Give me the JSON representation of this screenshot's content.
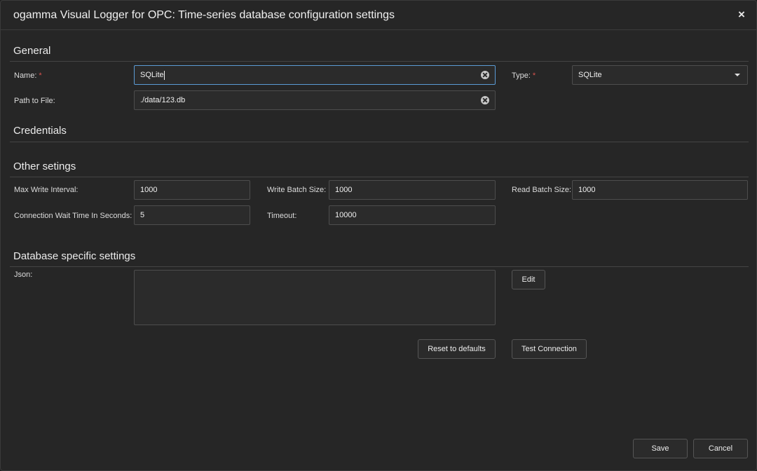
{
  "window": {
    "title": "ogamma Visual Logger for OPC: Time-series database configuration settings",
    "close_glyph": "×"
  },
  "sections": {
    "general": "General",
    "credentials": "Credentials",
    "other": "Other setings",
    "db_specific": "Database specific settings"
  },
  "general": {
    "name_label": "Name:",
    "name_required": "*",
    "name_value": "SQLite",
    "type_label": "Type:",
    "type_required": "*",
    "type_value": "SQLite",
    "path_label": "Path to File:",
    "path_value": "./data/123.db"
  },
  "other": {
    "max_write_interval_label": "Max Write Interval:",
    "max_write_interval_value": "1000",
    "write_batch_size_label": "Write Batch Size:",
    "write_batch_size_value": "1000",
    "read_batch_size_label": "Read Batch Size:",
    "read_batch_size_value": "1000",
    "conn_wait_label": "Connection Wait Time In Seconds:",
    "conn_wait_value": "5",
    "timeout_label": "Timeout:",
    "timeout_value": "10000"
  },
  "db_specific": {
    "json_label": "Json:",
    "json_value": "",
    "edit_button": "Edit",
    "reset_button": "Reset to defaults",
    "test_button": "Test Connection"
  },
  "footer": {
    "save_button": "Save",
    "cancel_button": "Cancel"
  },
  "icons": {
    "clear": "clear-circle-icon",
    "dropdown": "caret-down-icon"
  },
  "colors": {
    "background": "#262626",
    "focus_border": "#5b9bd5",
    "required": "#d9534f"
  }
}
